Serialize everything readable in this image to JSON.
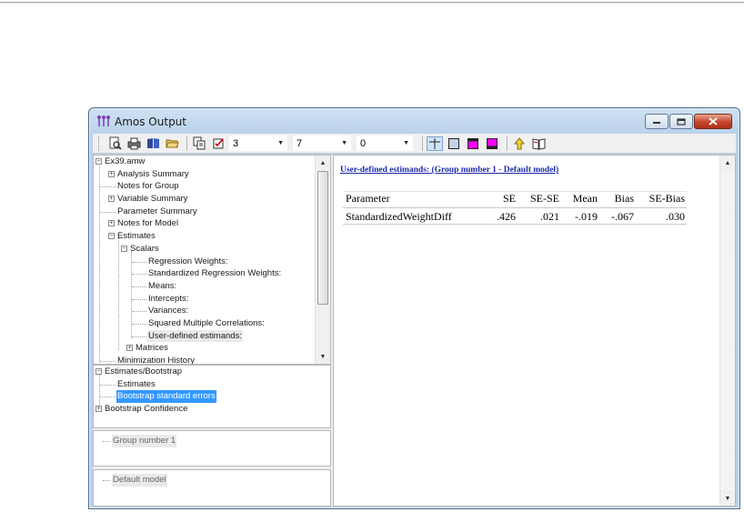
{
  "window": {
    "title": "Amos Output"
  },
  "toolbar": {
    "combo1": "3",
    "combo2": "7",
    "combo3": "0"
  },
  "tree": {
    "root": "Ex39.amw",
    "items": [
      "Analysis Summary",
      "Notes for Group",
      "Variable Summary",
      "Parameter Summary",
      "Notes for Model",
      "Estimates",
      "Scalars",
      "Regression Weights:",
      "Standardized Regression Weights:",
      "Means:",
      "Intercepts:",
      "Variances:",
      "Squared Multiple Correlations:",
      "User-defined estimands:",
      "Matrices",
      "Minimization History"
    ]
  },
  "bootstrap": {
    "root": "Estimates/Bootstrap",
    "items": [
      "Estimates",
      "Bootstrap standard errors",
      "Bootstrap Confidence"
    ]
  },
  "groups_pane": {
    "item": "Group number 1"
  },
  "models_pane": {
    "item": "Default model"
  },
  "output": {
    "heading": "User-defined estimands: (Group number 1 - Default model)",
    "columns": [
      "Parameter",
      "SE",
      "SE-SE",
      "Mean",
      "Bias",
      "SE-Bias"
    ],
    "rows": [
      [
        "StandardizedWeightDiff",
        ".426",
        ".021",
        "-.019",
        "-.067",
        ".030"
      ]
    ]
  }
}
